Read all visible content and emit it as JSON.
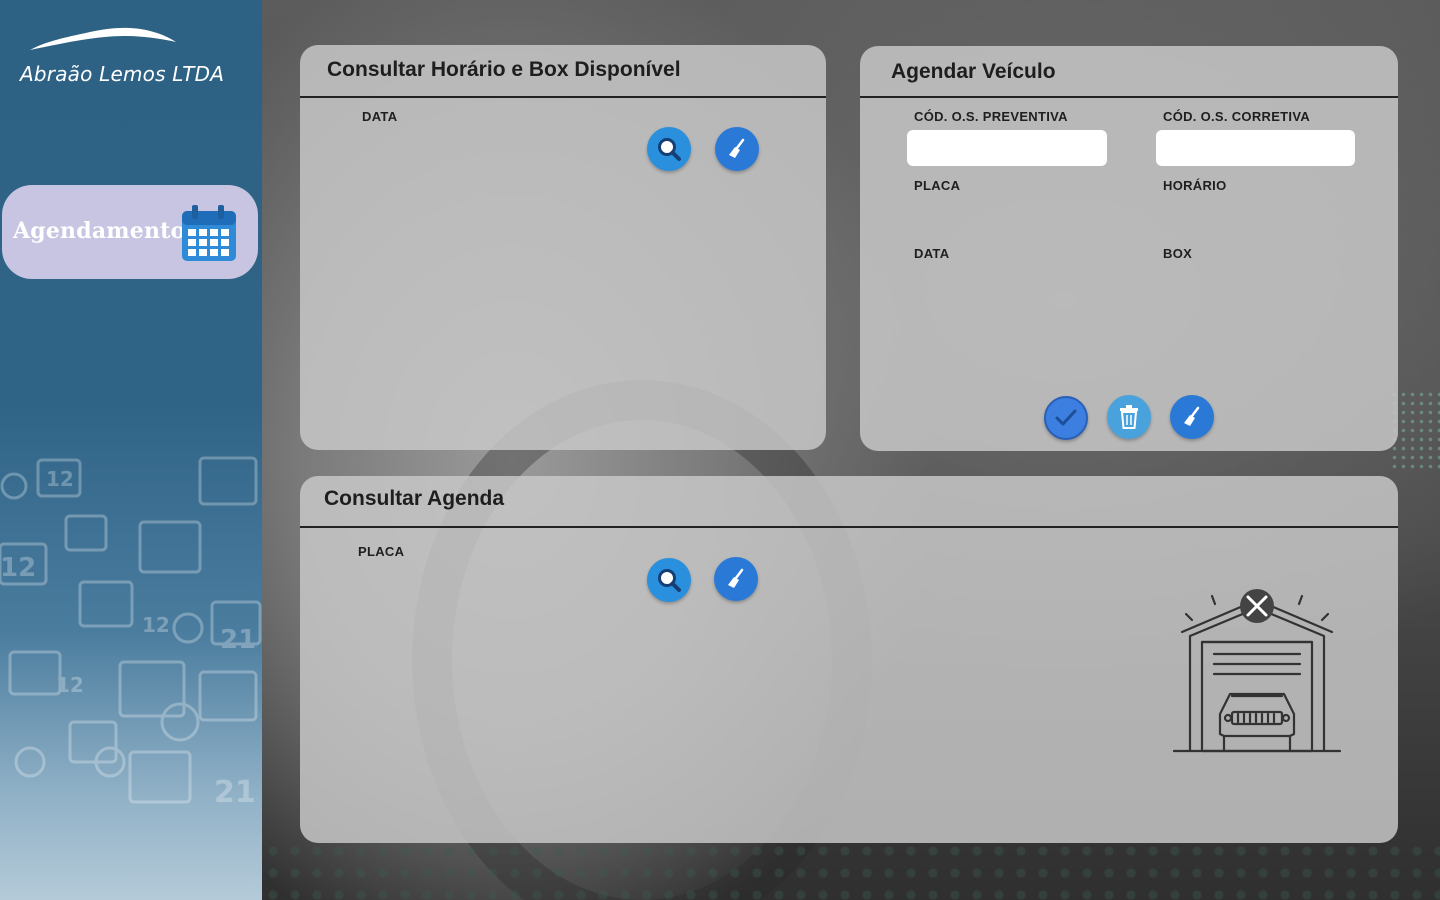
{
  "sidebar": {
    "brand": "Abraão Lemos LTDA",
    "nav_items": [
      {
        "label": "Agendamento",
        "icon": "calendar-icon"
      }
    ]
  },
  "consultar_horario": {
    "title": "Consultar Horário e Box Disponível",
    "fields": {
      "data_label": "DATA"
    },
    "buttons": {
      "search": "search-icon",
      "clear": "broom-icon"
    }
  },
  "agendar_veiculo": {
    "title": "Agendar Veículo",
    "fields": {
      "cod_preventiva_label": "CÓD. O.S. PREVENTIVA",
      "cod_preventiva_value": "",
      "cod_corretiva_label": "CÓD. O.S. CORRETIVA",
      "cod_corretiva_value": "",
      "placa_label": "PLACA",
      "horario_label": "HORÁRIO",
      "data_label": "DATA",
      "box_label": "BOX"
    },
    "buttons": {
      "confirm": "check-icon",
      "delete": "trash-icon",
      "clear": "broom-icon"
    }
  },
  "consultar_agenda": {
    "title": "Consultar Agenda",
    "fields": {
      "placa_label": "PLACA"
    },
    "buttons": {
      "search": "search-icon",
      "clear": "broom-icon"
    },
    "illustration": "garage-icon"
  },
  "colors": {
    "sidebar": "#306487",
    "nav_active": "#c7c5e2",
    "panel": "#c8c8c8",
    "button_blue": "#2a79d6"
  }
}
